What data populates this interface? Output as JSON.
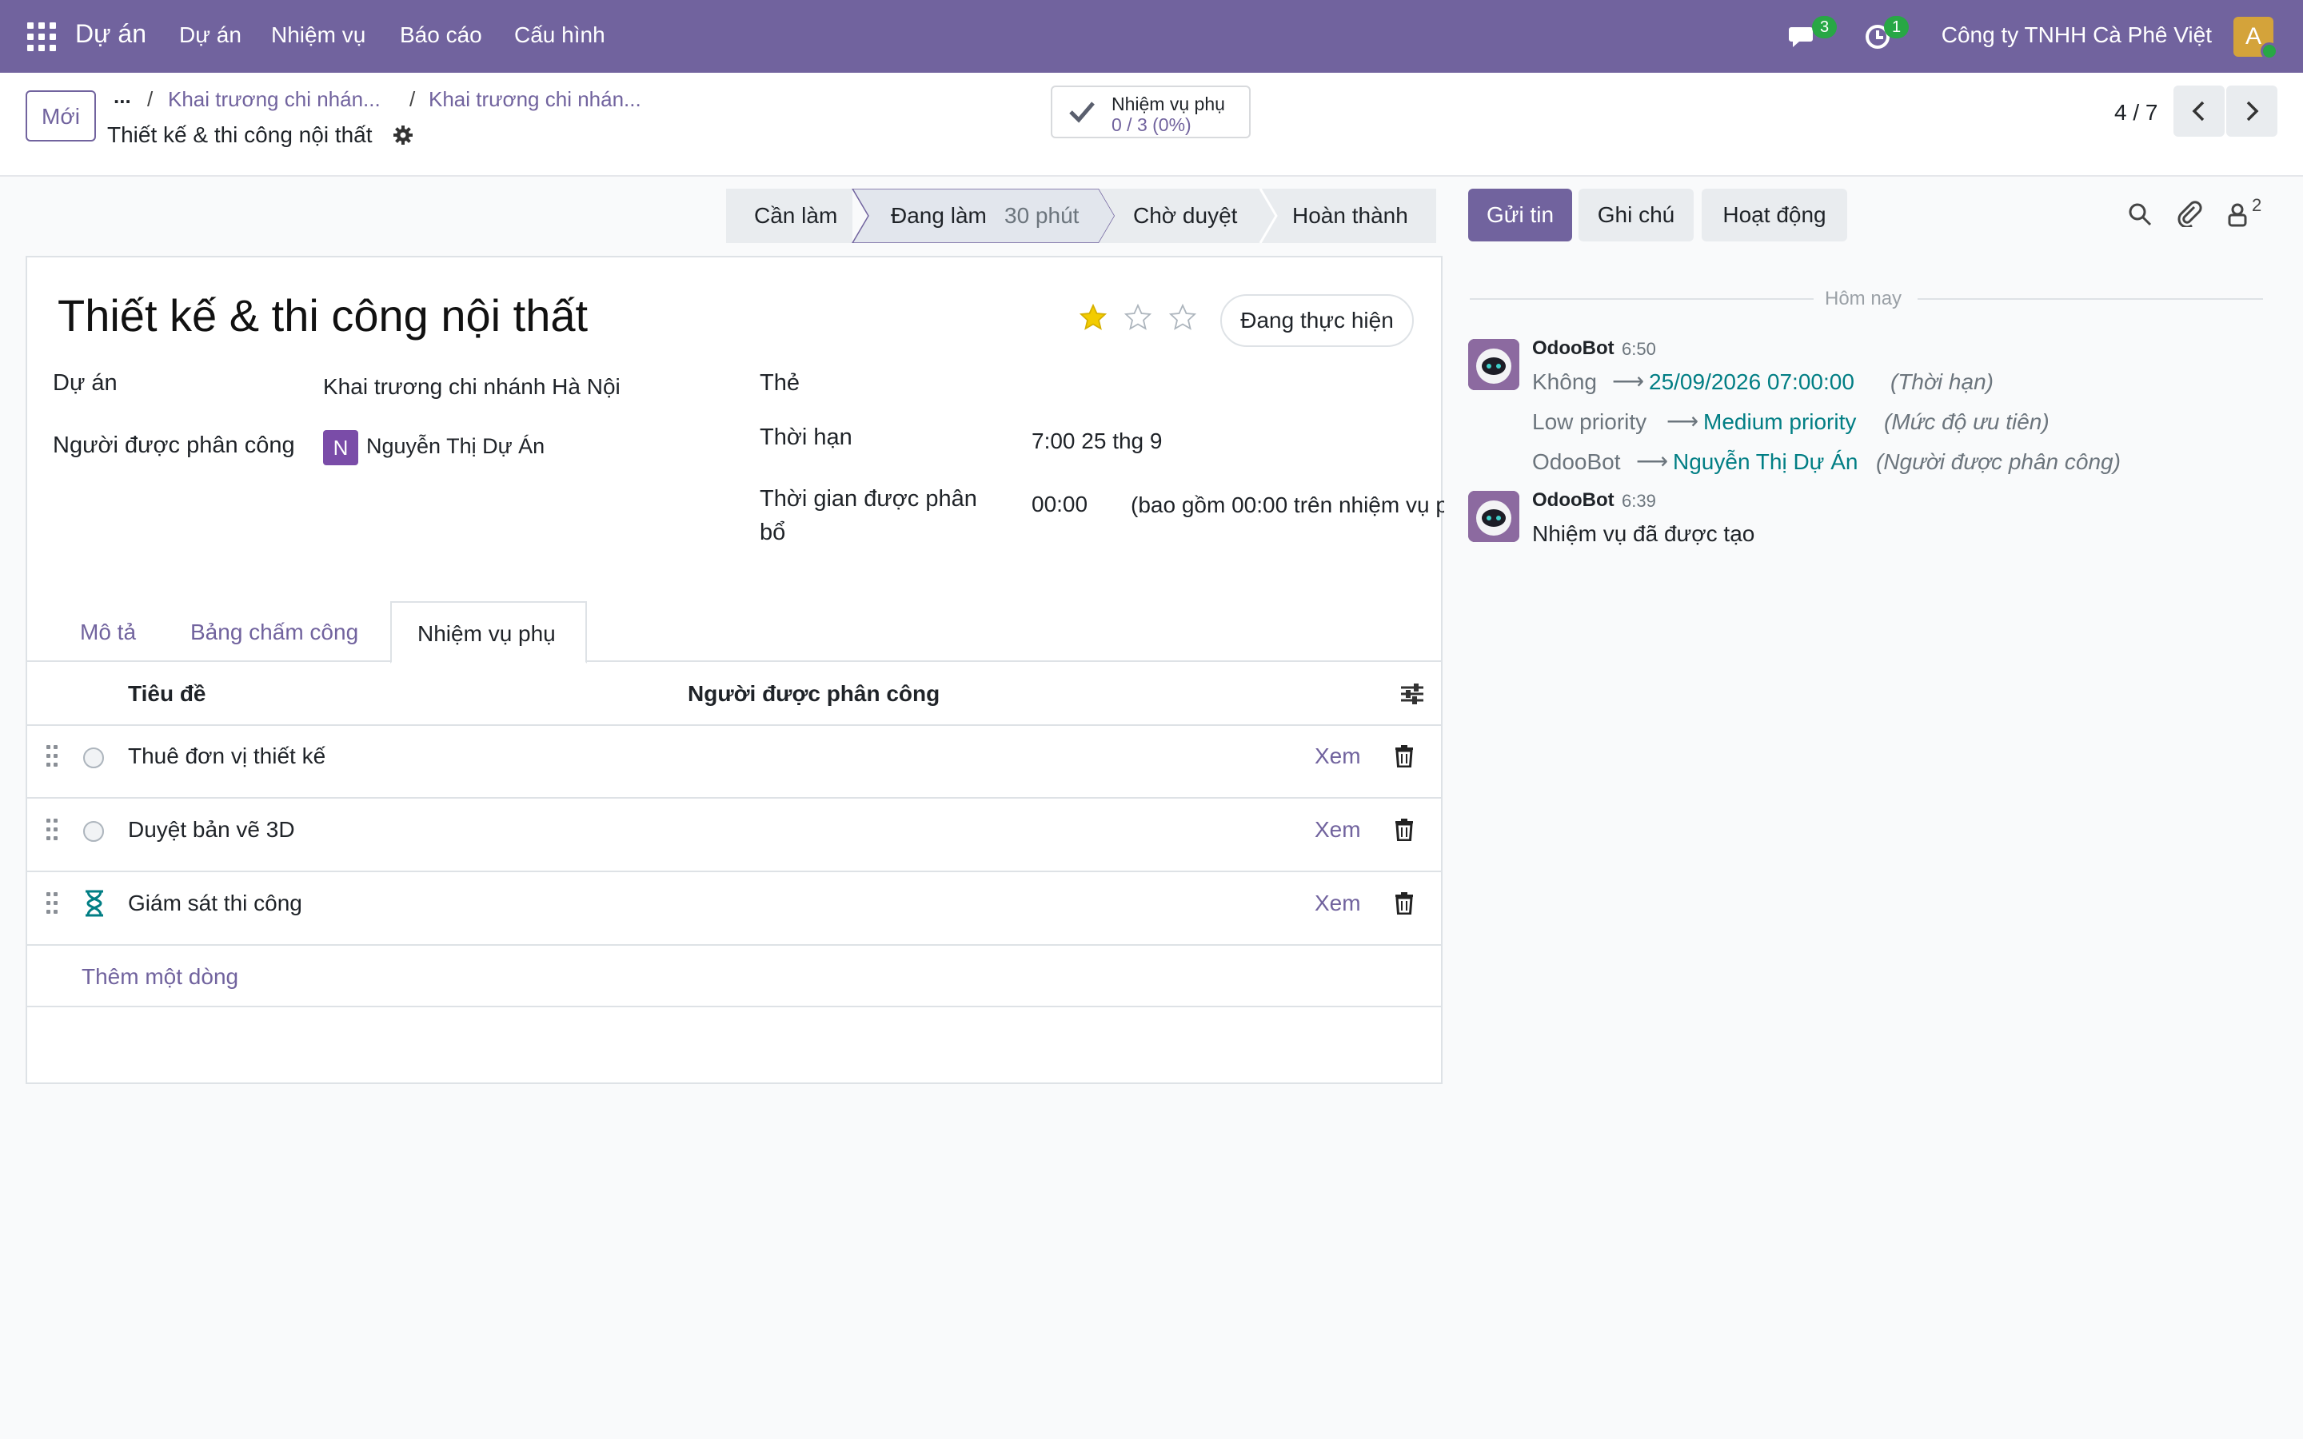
{
  "navbar": {
    "brand": "Dự án",
    "menus": [
      "Dự án",
      "Nhiệm vụ",
      "Báo cáo",
      "Cấu hình"
    ],
    "messages_count": "3",
    "activities_count": "1",
    "company": "Công ty TNHH Cà Phê Việt",
    "avatar_letter": "A"
  },
  "control_panel": {
    "new_button": "Mới",
    "breadcrumb_more": "...",
    "breadcrumbs": [
      "Khai trương chi nhán...",
      "Khai trương chi nhán..."
    ],
    "record_title": "Thiết kế & thi công nội thất",
    "subtasks_button": {
      "label": "Nhiệm vụ phụ",
      "progress": "0 / 3 (0%)"
    },
    "pager": "4 / 7"
  },
  "statusbar": {
    "stages": [
      "Cần làm",
      "Đang làm",
      "Chờ duyệt",
      "Hoàn thành"
    ],
    "current_stage_time": "30 phút",
    "current_index": 1
  },
  "form": {
    "title": "Thiết kế & thi công nội thất",
    "priority_stars": 1,
    "priority_max": 3,
    "state_button": "Đang thực hiện",
    "fields": {
      "project_label": "Dự án",
      "project_value": "Khai trương chi nhánh Hà Nội",
      "assignee_label": "Người được phân công",
      "assignee_initial": "N",
      "assignee_name": "Nguyễn Thị Dự Án",
      "tags_label": "Thẻ",
      "deadline_label": "Thời hạn",
      "deadline_value": "7:00 25 thg 9",
      "allocated_label_1": "Thời gian được phân",
      "allocated_label_2": "bổ",
      "allocated_value": "00:00",
      "allocated_note": "(bao gồm 00:00 trên nhiệm vụ p"
    },
    "tabs": [
      "Mô tả",
      "Bảng chấm công",
      "Nhiệm vụ phụ"
    ],
    "active_tab": 2,
    "subtasks": {
      "headers": [
        "Tiêu đề",
        "Người được phân công"
      ],
      "rows": [
        {
          "title": "Thuê đơn vị thiết kế",
          "status": "open",
          "action": "Xem"
        },
        {
          "title": "Duyệt bản vẽ 3D",
          "status": "open",
          "action": "Xem"
        },
        {
          "title": "Giám sát thi công",
          "status": "waiting",
          "action": "Xem"
        }
      ],
      "add_line": "Thêm một dòng"
    }
  },
  "chatter": {
    "buttons": [
      "Gửi tin",
      "Ghi chú",
      "Hoạt động"
    ],
    "followers_count": "2",
    "date_separator": "Hôm nay",
    "messages": [
      {
        "author": "OdooBot",
        "time": "6:50",
        "changes": [
          {
            "old": "Không",
            "new": "25/09/2026 07:00:00",
            "field": "(Thời hạn)"
          },
          {
            "old": "Low priority",
            "new": "Medium priority",
            "field": "(Mức độ ưu tiên)"
          },
          {
            "old": "OdooBot",
            "new": "Nguyễn Thị Dự Án",
            "field": "(Người được phân công)"
          }
        ]
      },
      {
        "author": "OdooBot",
        "time": "6:39",
        "body": "Nhiệm vụ đã được tạo"
      }
    ]
  },
  "colors": {
    "brand": "#71639e",
    "teal": "#017e84",
    "star": "#f3cc00",
    "badge": "#28a745"
  }
}
